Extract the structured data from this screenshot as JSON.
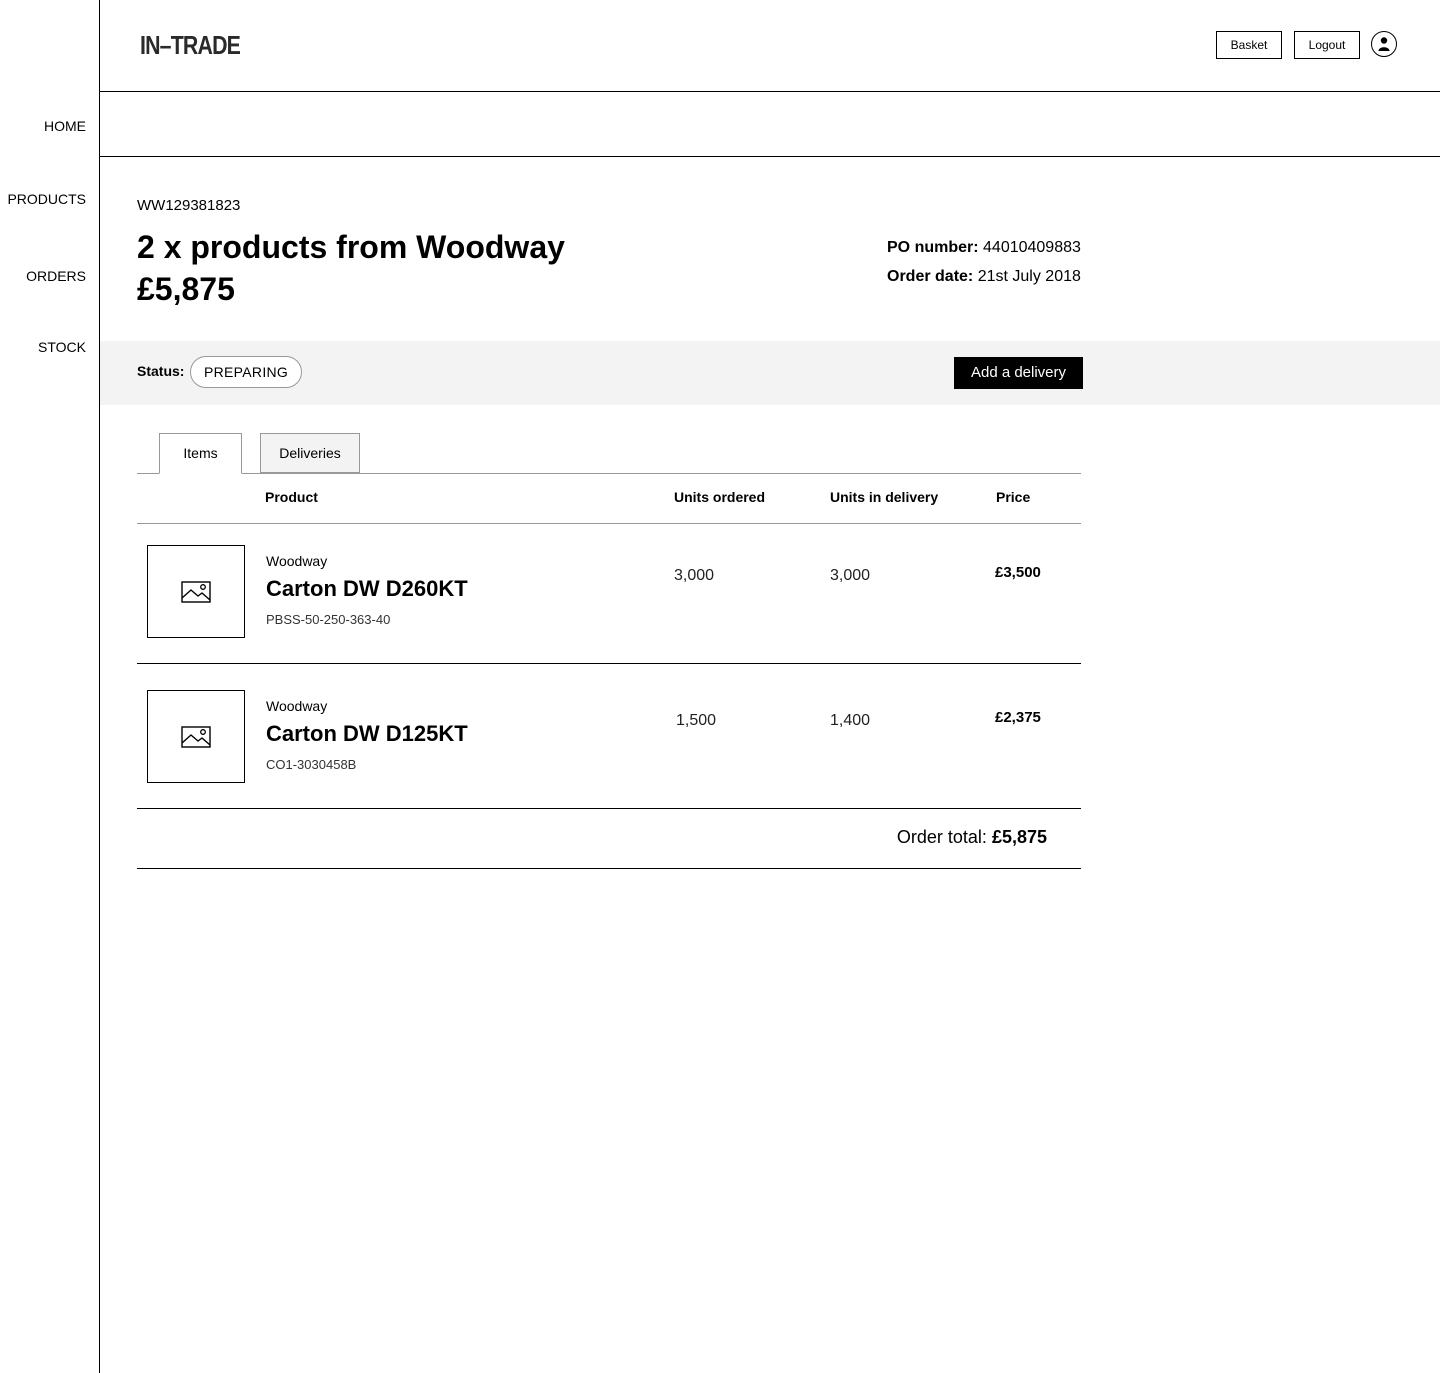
{
  "app": {
    "logo_text": "IN–TRADE"
  },
  "sidebar": {
    "items": [
      {
        "label": "HOME"
      },
      {
        "label": "PRODUCTS"
      },
      {
        "label": "ORDERS"
      },
      {
        "label": "STOCK"
      }
    ]
  },
  "header": {
    "basket_label": "Basket",
    "logout_label": "Logout",
    "avatar_icon": "user-icon"
  },
  "order": {
    "id": "WW129381823",
    "title": "2 x products from Woodway",
    "amount": "£5,875",
    "po_label": "PO number:",
    "po_value": "44010409883",
    "date_label": "Order date:",
    "date_value": "21st July 2018"
  },
  "status": {
    "label": "Status:",
    "value": "PREPARING",
    "add_delivery_label": "Add a delivery"
  },
  "tabs": [
    {
      "label": "Items",
      "active": true
    },
    {
      "label": "Deliveries",
      "active": false
    }
  ],
  "table": {
    "columns": [
      "Product",
      "Units ordered",
      "Units in delivery",
      "Price"
    ],
    "rows": [
      {
        "supplier": "Woodway",
        "name": "Carton DW D260KT",
        "sku": "PBSS-50-250-363-40",
        "units_ordered": "3,000",
        "units_in_delivery": "3,000",
        "price": "£3,500",
        "image_icon": "image-placeholder-icon"
      },
      {
        "supplier": "Woodway",
        "name": "Carton DW D125KT",
        "sku": "CO1-3030458B",
        "units_ordered": "1,500",
        "units_in_delivery": "1,400",
        "price": "£2,375",
        "image_icon": "image-placeholder-icon"
      }
    ],
    "total_label": "Order total:",
    "total_value": "£5,875"
  },
  "colors": {
    "accent": "#000000",
    "band_bg": "#f3f3f3",
    "border": "#000000",
    "tab_border": "#999999"
  }
}
